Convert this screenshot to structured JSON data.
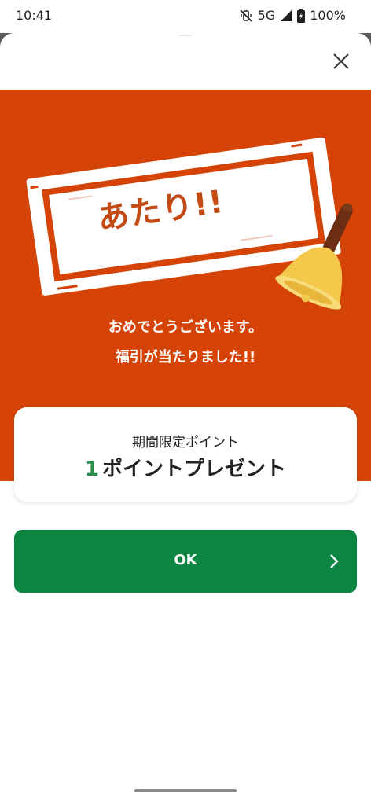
{
  "status_bar": {
    "time": "10:41",
    "network": "5G",
    "battery": "100%"
  },
  "dialog": {
    "close_icon": "close-icon",
    "banner": {
      "stamp_text": "あたり!!",
      "message_line1": "おめでとうございます。",
      "message_line2": "福引が当たりました!!",
      "background_color": "#d64307"
    },
    "point_card": {
      "label": "期間限定ポイント",
      "value_number": "1",
      "value_text": "ポイントプレゼント",
      "number_color": "#2e8b4a"
    },
    "ok_button": {
      "label": "OK",
      "color": "#0c8442",
      "icon": "chevron-right-icon"
    }
  }
}
